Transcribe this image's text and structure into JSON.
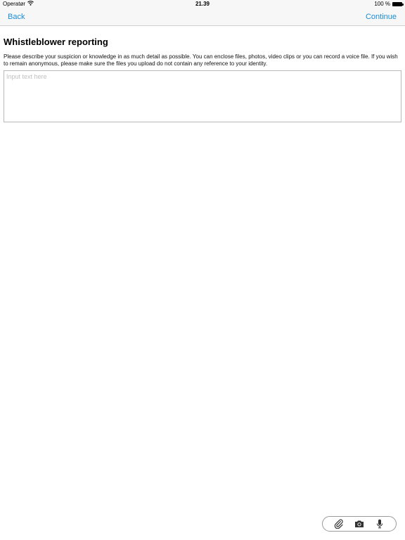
{
  "status": {
    "carrier": "Operatør",
    "time": "21.39",
    "battery_text": "100 %",
    "battery_level": 1.0
  },
  "nav": {
    "back_label": "Back",
    "continue_label": "Continue"
  },
  "main": {
    "title": "Whistleblower reporting",
    "description": "Please describe your suspicion or knowledge in as much detail as possible. You can enclose files, photos, video clips or you can record a voice file. If you wish to remain anonymous, please make sure the files you upload do not contain any reference to your identity.",
    "input_placeholder": "Input text here",
    "input_value": ""
  },
  "toolbar": {
    "icons": [
      "paperclip-icon",
      "camera-icon",
      "microphone-icon"
    ]
  },
  "colors": {
    "accent": "#1a8cd8",
    "nav_background": "#f7f7f7"
  }
}
